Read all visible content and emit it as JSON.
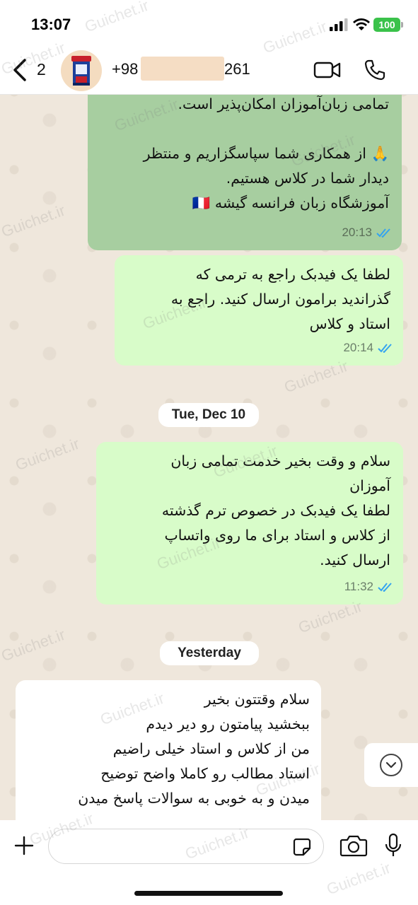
{
  "status_bar": {
    "time": "13:07",
    "battery": "100"
  },
  "header": {
    "back_count": "2",
    "phone_prefix": "+98",
    "phone_suffix": "261"
  },
  "messages": [
    {
      "type": "outgoing",
      "lines": [
        "تمامی زبان‌آموزان امکان‌پذیر است.",
        "",
        "🙏 از همکاری شما سپاسگزاریم و منتظر",
        "دیدار شما در کلاس هستیم.",
        "آموزشگاه زبان فرانسه گیشه 🇫🇷"
      ],
      "time": "20:13"
    },
    {
      "type": "outgoing",
      "lines": [
        "لطفا یک فیدبک راجع به ترمی که",
        "گذراندید برامون ارسال کنید. راجع به",
        "استاد و کلاس"
      ],
      "time": "20:14"
    },
    {
      "type": "outgoing",
      "lines": [
        "سلام و وقت بخیر خدمت تمامی زبان",
        "آموزان",
        "لطفا یک فیدبک در خصوص ترم گذشته",
        "از کلاس و استاد برای ما روی واتساپ",
        "ارسال کنید."
      ],
      "time": "11:32"
    },
    {
      "type": "incoming",
      "lines": [
        "سلام وقتتون بخیر",
        "ببخشید پیامتون رو دیر دیدم",
        "من از کلاس و استاد خیلی راضیم",
        "استاد مطالب رو کاملا واضح توضیح",
        "میدن و به خوبی به سوالات پاسخ میدن"
      ]
    }
  ],
  "date_separators": [
    "Tue, Dec 10",
    "Yesterday"
  ],
  "watermark": "Guichet.ir",
  "icons": {
    "back": "chevron-left-icon",
    "video": "video-camera-icon",
    "call": "phone-icon",
    "plus": "plus-icon",
    "sticker": "sticker-icon",
    "camera": "camera-icon",
    "mic": "microphone-icon",
    "scroll": "chevron-down-icon"
  },
  "colors": {
    "outgoing_bubble": "#d8fcc9",
    "highlighted_bubble": "#a7cea0",
    "incoming_bubble": "#ffffff",
    "read_ticks": "#34a3f0",
    "wallpaper": "#efe7dc"
  }
}
